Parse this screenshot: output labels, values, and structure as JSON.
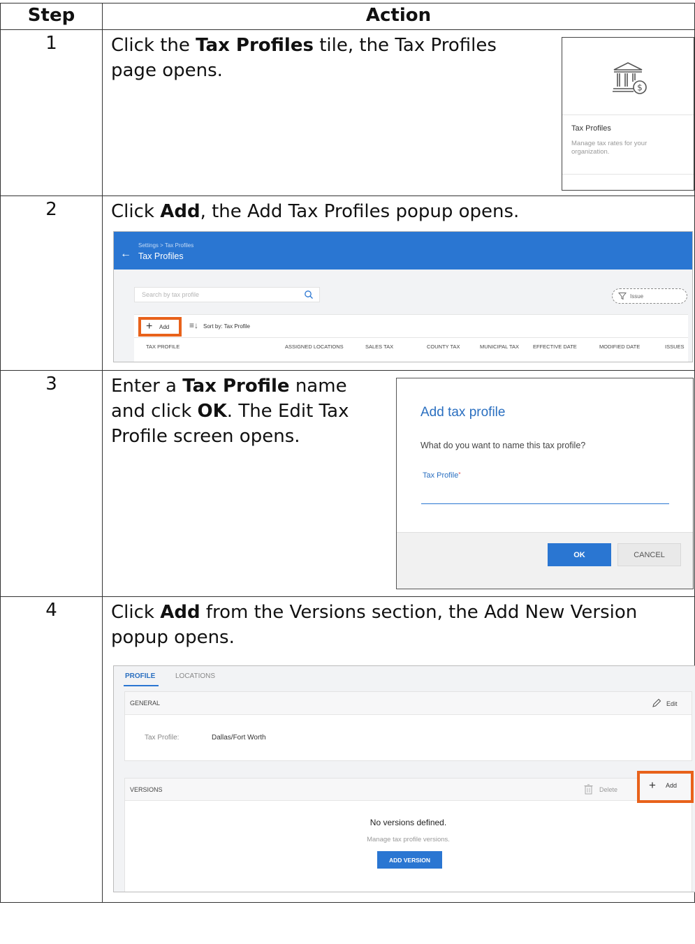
{
  "table": {
    "header_step": "Step",
    "header_action": "Action"
  },
  "steps": [
    {
      "number": "1",
      "text_pre": "Click the ",
      "text_bold": "Tax Profiles",
      "text_post1": " tile, the Tax Profiles",
      "text_post2": "page opens.",
      "tile": {
        "title": "Tax Profiles",
        "description": "Manage tax rates for your organization.",
        "icon": "bank-dollar-icon"
      }
    },
    {
      "number": "2",
      "text_pre": "Click ",
      "text_bold": "Add",
      "text_post": ", the Add Tax Profiles popup opens.",
      "screen": {
        "breadcrumb": "Settings > Tax Profiles",
        "title": "Tax Profiles",
        "search_placeholder": "Search by tax profile",
        "filter_label": "Issue",
        "add_label": "Add",
        "sort_label": "Sort by: Tax Profile",
        "columns": [
          "TAX PROFILE",
          "ASSIGNED LOCATIONS",
          "SALES TAX",
          "COUNTY TAX",
          "MUNICIPAL TAX",
          "EFFECTIVE DATE",
          "MODIFIED DATE",
          "ISSUES"
        ]
      }
    },
    {
      "number": "3",
      "line1_pre": "Enter a ",
      "line1_bold": "Tax Profile",
      "line1_post": " name",
      "line2_pre": "and click ",
      "line2_bold": "OK",
      "line2_post": ". The Edit Tax",
      "line3": "Profile screen opens.",
      "dialog": {
        "title": "Add tax profile",
        "question": "What do you want to name this tax profile?",
        "field_label": "Tax Profile",
        "required_mark": "*",
        "field_value": "",
        "ok_label": "OK",
        "cancel_label": "CANCEL"
      }
    },
    {
      "number": "4",
      "line1_pre": "Click ",
      "line1_bold": "Add",
      "line1_post": " from the Versions section, the Add New Version",
      "line2": "popup opens.",
      "screen": {
        "tab_profile": "PROFILE",
        "tab_locations": "LOCATIONS",
        "general_title": "GENERAL",
        "edit_label": "Edit",
        "tax_profile_label": "Tax Profile:",
        "tax_profile_value": "Dallas/Fort Worth",
        "versions_title": "VERSIONS",
        "delete_label": "Delete",
        "add_label": "Add",
        "empty_title": "No versions defined.",
        "empty_subtitle": "Manage tax profile versions.",
        "add_version_label": "ADD VERSION"
      }
    }
  ],
  "colors": {
    "accent_blue": "#2a76d2",
    "highlight_orange": "#e8621b"
  }
}
